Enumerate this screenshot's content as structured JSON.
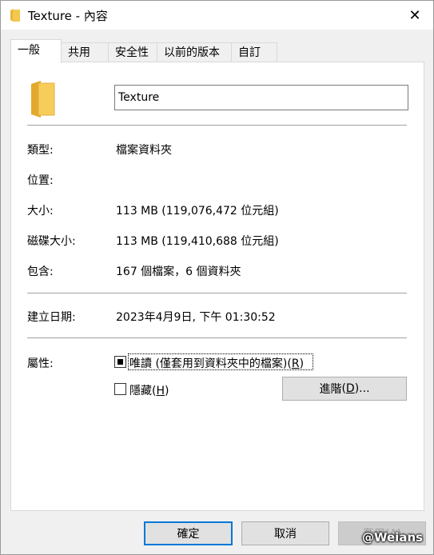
{
  "window": {
    "title": "Texture - 內容",
    "close_glyph": "✕"
  },
  "tabs": [
    {
      "label": "一般"
    },
    {
      "label": "共用"
    },
    {
      "label": "安全性"
    },
    {
      "label": "以前的版本"
    },
    {
      "label": "自訂"
    }
  ],
  "general": {
    "name_value": "Texture",
    "type_label": "類型:",
    "type_value": "檔案資料夾",
    "location_label": "位置:",
    "location_value": "",
    "size_label": "大小:",
    "size_value": "113 MB (119,076,472 位元組)",
    "disk_size_label": "磁碟大小:",
    "disk_size_value": "113 MB (119,410,688 位元組)",
    "contains_label": "包含:",
    "contains_value": "167 個檔案，6 個資料夾",
    "created_label": "建立日期:",
    "created_value": "2023年4月9日, 下午 01:30:52",
    "attributes_label": "屬性:",
    "readonly_label": "唯讀 (僅套用到資料夾中的檔案)",
    "readonly_key": "R",
    "hidden_label": "隱藏",
    "hidden_key": "H",
    "advanced_label": "進階",
    "advanced_key": "D",
    "advanced_suffix": "..."
  },
  "buttons": {
    "ok_label": "確定",
    "cancel_label": "取消",
    "apply_label": "套用(A)"
  },
  "watermark": "@Weians",
  "colors": {
    "accent": "#0078d7",
    "folder": "#f4c84e"
  }
}
